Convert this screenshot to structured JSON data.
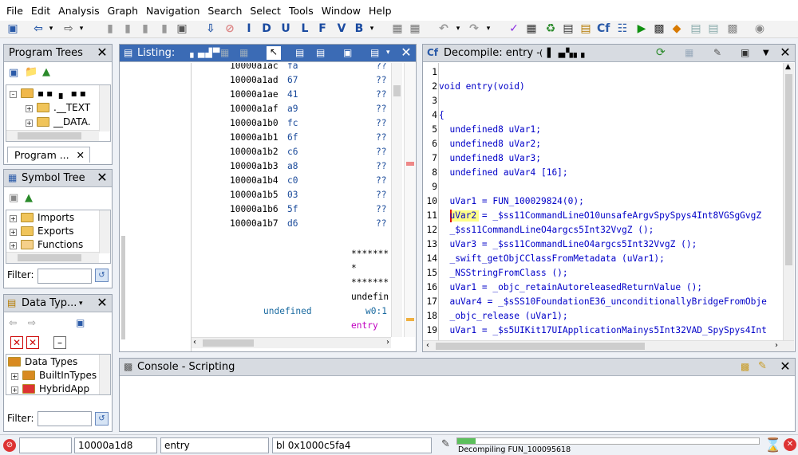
{
  "menu": [
    "File",
    "Edit",
    "Analysis",
    "Graph",
    "Navigation",
    "Search",
    "Select",
    "Tools",
    "Window",
    "Help"
  ],
  "toolbar_icons": [
    "save-icon",
    "back-icon",
    "forward-icon",
    "bookmark-icon",
    "disassemble-icon",
    "down-arrow-icon",
    "stop-icon",
    "I",
    "D",
    "U",
    "L",
    "F",
    "V",
    "B",
    "clear-icon",
    "undo-icon",
    "redo-icon",
    "check-icon",
    "run-script-icon",
    "green-refresh-icon"
  ],
  "toolbar_letters": [
    "I",
    "D",
    "U",
    "L",
    "F",
    "V",
    "B"
  ],
  "program_trees": {
    "title": "Program Trees",
    "tree": [
      ".__TEXT",
      "__DATA."
    ],
    "tab": "Program ..."
  },
  "symbol_tree": {
    "title": "Symbol Tree",
    "items": [
      "Imports",
      "Exports",
      "Functions"
    ],
    "filter_label": "Filter:"
  },
  "data_types": {
    "title": "Data Typ...",
    "items": [
      "Data Types",
      "BuiltInTypes",
      "HybridApp"
    ],
    "filter_label": "Filter:"
  },
  "listing": {
    "title": "Listing:",
    "rows": [
      {
        "addr": "10000a1ac",
        "byte": "fa",
        "q": "??"
      },
      {
        "addr": "10000a1ad",
        "byte": "67",
        "q": "??"
      },
      {
        "addr": "10000a1ae",
        "byte": "41",
        "q": "??"
      },
      {
        "addr": "10000a1af",
        "byte": "a9",
        "q": "??"
      },
      {
        "addr": "10000a1b0",
        "byte": "fc",
        "q": "??"
      },
      {
        "addr": "10000a1b1",
        "byte": "6f",
        "q": "??"
      },
      {
        "addr": "10000a1b2",
        "byte": "c6",
        "q": "??"
      },
      {
        "addr": "10000a1b3",
        "byte": "a8",
        "q": "??"
      },
      {
        "addr": "10000a1b4",
        "byte": "c0",
        "q": "??"
      },
      {
        "addr": "10000a1b5",
        "byte": "03",
        "q": "??"
      },
      {
        "addr": "10000a1b6",
        "byte": "5f",
        "q": "??"
      },
      {
        "addr": "10000a1b7",
        "byte": "d6",
        "q": "??"
      }
    ],
    "stars1": "*******",
    "stars2": "*",
    "stars3": "*******",
    "undefin": "undefin",
    "undefined": "undefined",
    "w01": "w0:1",
    "entry": "entry"
  },
  "decompile": {
    "title": "Decompile: entry -",
    "lines": [
      {
        "n": "1",
        "t": ""
      },
      {
        "n": "2",
        "t": "void entry(void)"
      },
      {
        "n": "3",
        "t": ""
      },
      {
        "n": "4",
        "t": "{"
      },
      {
        "n": "5",
        "t": "  undefined8 uVar1;"
      },
      {
        "n": "6",
        "t": "  undefined8 uVar2;"
      },
      {
        "n": "7",
        "t": "  undefined8 uVar3;"
      },
      {
        "n": "8",
        "t": "  undefined auVar4 [16];"
      },
      {
        "n": "9",
        "t": ""
      },
      {
        "n": "10",
        "t": "  uVar1 = FUN_100029824(0);"
      },
      {
        "n": "11",
        "t": "  uVar2 = _$ss11CommandLineO10unsafeArgvSpySpys4Int8VGSgGvgZ"
      },
      {
        "n": "12",
        "t": "  _$ss11CommandLineO4argcs5Int32VvgZ ();"
      },
      {
        "n": "13",
        "t": "  uVar3 = _$ss11CommandLineO4argcs5Int32VvgZ ();"
      },
      {
        "n": "14",
        "t": "  _swift_getObjCClassFromMetadata (uVar1);"
      },
      {
        "n": "15",
        "t": "  _NSStringFromClass ();"
      },
      {
        "n": "16",
        "t": "  uVar1 = _objc_retainAutoreleasedReturnValue ();"
      },
      {
        "n": "17",
        "t": "  auVar4 = _$sSS10FoundationE36_unconditionallyBridgeFromObje"
      },
      {
        "n": "18",
        "t": "  _objc_release (uVar1);"
      },
      {
        "n": "19",
        "t": "  uVar1 = _$s5UIKit17UIApplicationMainys5Int32VAD_SpySpys4Int"
      },
      {
        "n": "20",
        "t": ""
      }
    ]
  },
  "console": {
    "title": "Console - Scripting"
  },
  "status": {
    "address": "10000a1d8",
    "function": "entry",
    "instruction": "bl 0x1000c5fa4",
    "decompiling": "Decompiling FUN_100095618"
  },
  "colors": {
    "accent": "#3b6bb5",
    "listing_addr": "#000000",
    "keyword": "#0000c8",
    "var": "#7a5b00",
    "number": "#009000",
    "highlight": "#ffff88"
  }
}
